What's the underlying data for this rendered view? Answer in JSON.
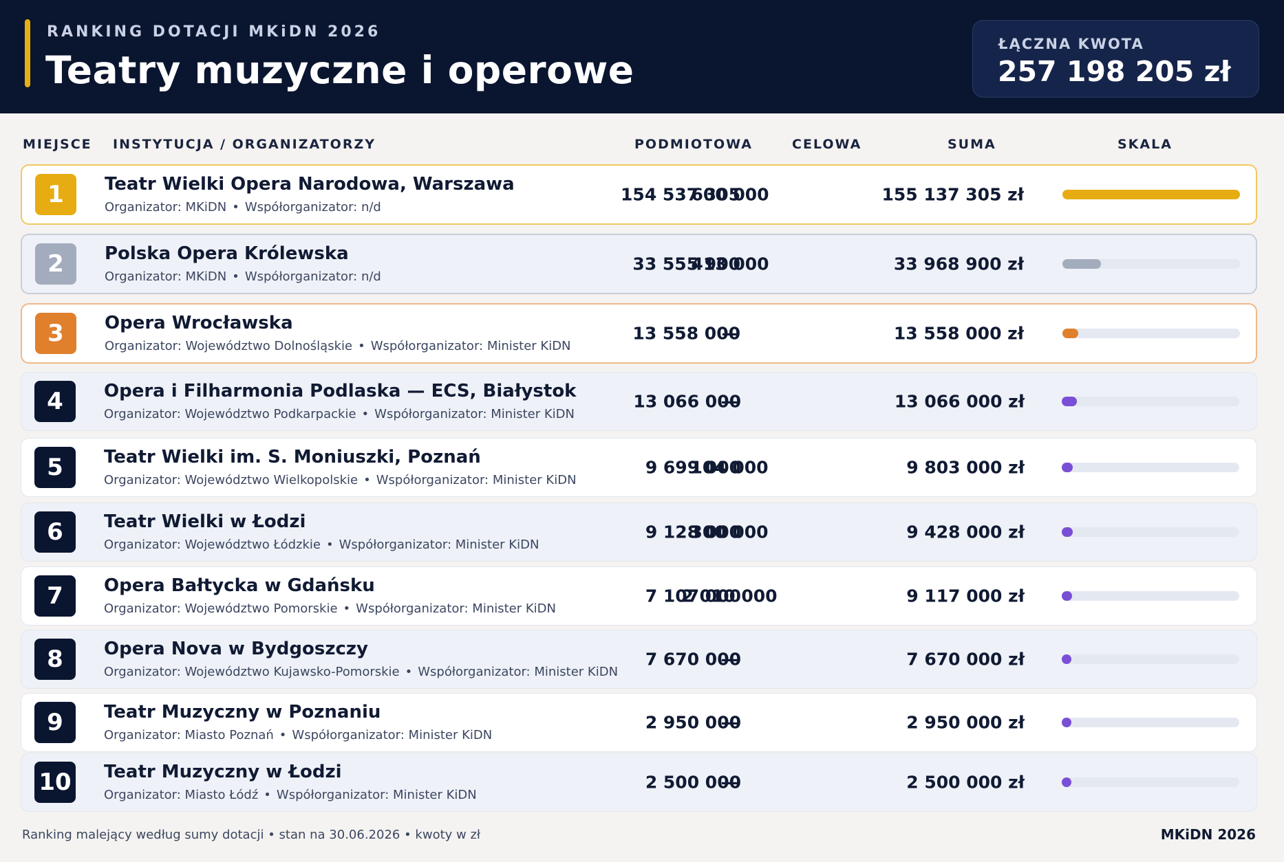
{
  "header": {
    "kicker": "RANKING DOTACJI MKiDN 2026",
    "title": "Teatry muzyczne i operowe",
    "total_label": "ŁĄCZNA KWOTA",
    "total_value": "257 198 205 zł"
  },
  "columns": {
    "rank": "MIEJSCE",
    "institution": "INSTYTUCJA / ORGANIZATORZY",
    "podmiotowa": "PODMIOTOWA",
    "celowa": "CELOWA",
    "suma": "SUMA",
    "skala": "SKALA"
  },
  "chart_data": {
    "type": "table",
    "scale_max": 155137305,
    "colors": {
      "gold": "#e6ac12",
      "silver": "#a3acbd",
      "bronze": "#e0802d",
      "default": "#7a4fd6"
    },
    "rows": [
      {
        "rank": "1",
        "name": "Teatr Wielki Opera Narodowa, Warszawa",
        "organizer": "Organizator: MKiDN",
        "coorganizer": "Współorganizator: n/d",
        "podmiotowa": "154 537 305",
        "celowa": "600 000",
        "suma": "155 137 305 zł",
        "suma_value": 155137305,
        "medal": "gold"
      },
      {
        "rank": "2",
        "name": "Polska Opera Królewska",
        "organizer": "Organizator: MKiDN",
        "coorganizer": "Współorganizator: n/d",
        "podmiotowa": "33 555 900",
        "celowa": "413 000",
        "suma": "33 968 900 zł",
        "suma_value": 33968900,
        "medal": "silver"
      },
      {
        "rank": "3",
        "name": "Opera Wrocławska",
        "organizer": "Organizator: Województwo Dolnośląskie",
        "coorganizer": "Współorganizator: Minister KiDN",
        "podmiotowa": "13 558 000",
        "celowa": "—",
        "suma": "13 558 000 zł",
        "suma_value": 13558000,
        "medal": "bronze"
      },
      {
        "rank": "4",
        "name": "Opera i Filharmonia Podlaska — ECS, Białystok",
        "organizer": "Organizator: Województwo Podkarpackie",
        "coorganizer": "Współorganizator: Minister KiDN",
        "podmiotowa": "13 066 000",
        "celowa": "—",
        "suma": "13 066 000 zł",
        "suma_value": 13066000,
        "medal": ""
      },
      {
        "rank": "5",
        "name": "Teatr Wielki im. S. Moniuszki, Poznań",
        "organizer": "Organizator: Województwo Wielkopolskie",
        "coorganizer": "Współorganizator: Minister KiDN",
        "podmiotowa": "9 699 000",
        "celowa": "104 000",
        "suma": "9 803 000 zł",
        "suma_value": 9803000,
        "medal": ""
      },
      {
        "rank": "6",
        "name": "Teatr Wielki w Łodzi",
        "organizer": "Organizator: Województwo Łódzkie",
        "coorganizer": "Współorganizator: Minister KiDN",
        "podmiotowa": "9 128 000",
        "celowa": "300 000",
        "suma": "9 428 000 zł",
        "suma_value": 9428000,
        "medal": ""
      },
      {
        "rank": "7",
        "name": "Opera Bałtycka w Gdańsku",
        "organizer": "Organizator: Województwo Pomorskie",
        "coorganizer": "Współorganizator: Minister KiDN",
        "podmiotowa": "7 107 000",
        "celowa": "2 010 000",
        "suma": "9 117 000 zł",
        "suma_value": 9117000,
        "medal": ""
      },
      {
        "rank": "8",
        "name": "Opera Nova w Bydgoszczy",
        "organizer": "Organizator: Województwo Kujawsko-Pomorskie",
        "coorganizer": "Współorganizator: Minister KiDN",
        "podmiotowa": "7 670 000",
        "celowa": "—",
        "suma": "7 670 000 zł",
        "suma_value": 7670000,
        "medal": ""
      },
      {
        "rank": "9",
        "name": "Teatr Muzyczny w Poznaniu",
        "organizer": "Organizator: Miasto Poznań",
        "coorganizer": "Współorganizator: Minister KiDN",
        "podmiotowa": "2 950 000",
        "celowa": "—",
        "suma": "2 950 000 zł",
        "suma_value": 2950000,
        "medal": ""
      },
      {
        "rank": "10",
        "name": "Teatr Muzyczny w Łodzi",
        "organizer": "Organizator: Miasto Łódź",
        "coorganizer": "Współorganizator: Minister KiDN",
        "podmiotowa": "2 500 000",
        "celowa": "—",
        "suma": "2 500 000 zł",
        "suma_value": 2500000,
        "medal": ""
      }
    ]
  },
  "footer": {
    "note": "Ranking malejący według sumy dotacji • stan na 30.06.2026 • kwoty w zł",
    "brand": "MKiDN 2026"
  }
}
